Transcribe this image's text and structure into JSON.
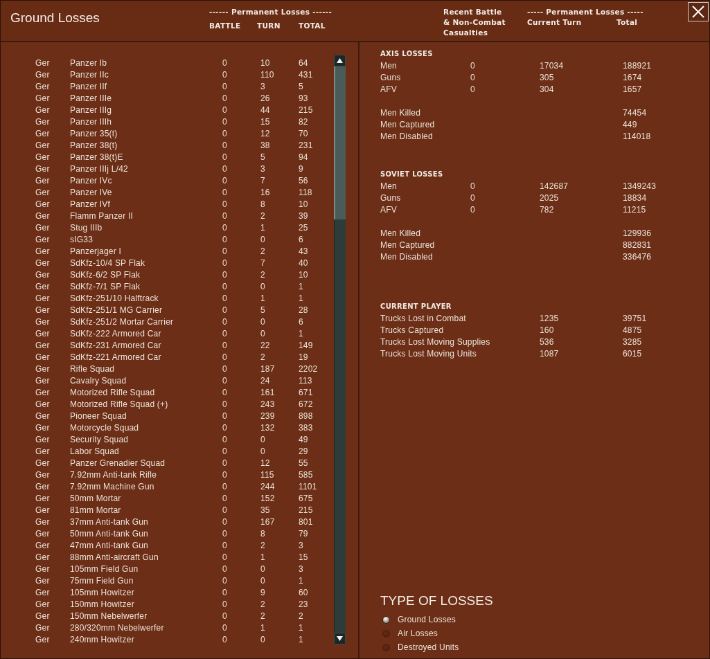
{
  "header": {
    "title": "Ground Losses",
    "unit_losses_heading": "------ Permanent Losses ------",
    "unit_columns": [
      "BATTLE",
      "TURN",
      "TOTAL"
    ],
    "recent_heading": [
      "Recent Battle",
      "& Non-Combat",
      "Casualties"
    ],
    "summary_heading": "----- Permanent Losses -----",
    "summary_columns": [
      "Current Turn",
      "Total"
    ]
  },
  "units": [
    {
      "nation": "Ger",
      "name": "Panzer Ib",
      "battle": "0",
      "turn": "10",
      "total": "64"
    },
    {
      "nation": "Ger",
      "name": "Panzer IIc",
      "battle": "0",
      "turn": "110",
      "total": "431"
    },
    {
      "nation": "Ger",
      "name": "Panzer IIf",
      "battle": "0",
      "turn": "3",
      "total": "5"
    },
    {
      "nation": "Ger",
      "name": "Panzer IIIe",
      "battle": "0",
      "turn": "26",
      "total": "93"
    },
    {
      "nation": "Ger",
      "name": "Panzer IIIg",
      "battle": "0",
      "turn": "44",
      "total": "215"
    },
    {
      "nation": "Ger",
      "name": "Panzer IIIh",
      "battle": "0",
      "turn": "15",
      "total": "82"
    },
    {
      "nation": "Ger",
      "name": "Panzer 35(t)",
      "battle": "0",
      "turn": "12",
      "total": "70"
    },
    {
      "nation": "Ger",
      "name": "Panzer 38(t)",
      "battle": "0",
      "turn": "38",
      "total": "231"
    },
    {
      "nation": "Ger",
      "name": "Panzer 38(t)E",
      "battle": "0",
      "turn": "5",
      "total": "94"
    },
    {
      "nation": "Ger",
      "name": "Panzer IIIj L/42",
      "battle": "0",
      "turn": "3",
      "total": "9"
    },
    {
      "nation": "Ger",
      "name": "Panzer IVc",
      "battle": "0",
      "turn": "7",
      "total": "56"
    },
    {
      "nation": "Ger",
      "name": "Panzer IVe",
      "battle": "0",
      "turn": "16",
      "total": "118"
    },
    {
      "nation": "Ger",
      "name": "Panzer IVf",
      "battle": "0",
      "turn": "8",
      "total": "10"
    },
    {
      "nation": "Ger",
      "name": "Flamm Panzer II",
      "battle": "0",
      "turn": "2",
      "total": "39"
    },
    {
      "nation": "Ger",
      "name": "Stug IIIb",
      "battle": "0",
      "turn": "1",
      "total": "25"
    },
    {
      "nation": "Ger",
      "name": "sIG33",
      "battle": "0",
      "turn": "0",
      "total": "6"
    },
    {
      "nation": "Ger",
      "name": "Panzerjager I",
      "battle": "0",
      "turn": "2",
      "total": "43"
    },
    {
      "nation": "Ger",
      "name": "SdKfz-10/4 SP Flak",
      "battle": "0",
      "turn": "7",
      "total": "40"
    },
    {
      "nation": "Ger",
      "name": "SdKfz-6/2 SP Flak",
      "battle": "0",
      "turn": "2",
      "total": "10"
    },
    {
      "nation": "Ger",
      "name": "SdKfz-7/1 SP Flak",
      "battle": "0",
      "turn": "0",
      "total": "1"
    },
    {
      "nation": "Ger",
      "name": "SdKfz-251/10 Halftrack",
      "battle": "0",
      "turn": "1",
      "total": "1"
    },
    {
      "nation": "Ger",
      "name": "SdKfz-251/1 MG Carrier",
      "battle": "0",
      "turn": "5",
      "total": "28"
    },
    {
      "nation": "Ger",
      "name": "SdKfz-251/2 Mortar Carrier",
      "battle": "0",
      "turn": "0",
      "total": "6"
    },
    {
      "nation": "Ger",
      "name": "SdKfz-222 Armored Car",
      "battle": "0",
      "turn": "0",
      "total": "1"
    },
    {
      "nation": "Ger",
      "name": "SdKfz-231 Armored Car",
      "battle": "0",
      "turn": "22",
      "total": "149"
    },
    {
      "nation": "Ger",
      "name": "SdKfz-221 Armored Car",
      "battle": "0",
      "turn": "2",
      "total": "19"
    },
    {
      "nation": "Ger",
      "name": "Rifle Squad",
      "battle": "0",
      "turn": "187",
      "total": "2202"
    },
    {
      "nation": "Ger",
      "name": "Cavalry Squad",
      "battle": "0",
      "turn": "24",
      "total": "113"
    },
    {
      "nation": "Ger",
      "name": "Motorized Rifle Squad",
      "battle": "0",
      "turn": "161",
      "total": "671"
    },
    {
      "nation": "Ger",
      "name": "Motorized Rifle Squad (+)",
      "battle": "0",
      "turn": "243",
      "total": "672"
    },
    {
      "nation": "Ger",
      "name": "Pioneer Squad",
      "battle": "0",
      "turn": "239",
      "total": "898"
    },
    {
      "nation": "Ger",
      "name": "Motorcycle Squad",
      "battle": "0",
      "turn": "132",
      "total": "383"
    },
    {
      "nation": "Ger",
      "name": "Security Squad",
      "battle": "0",
      "turn": "0",
      "total": "49"
    },
    {
      "nation": "Ger",
      "name": "Labor Squad",
      "battle": "0",
      "turn": "0",
      "total": "29"
    },
    {
      "nation": "Ger",
      "name": "Panzer Grenadier Squad",
      "battle": "0",
      "turn": "12",
      "total": "55"
    },
    {
      "nation": "Ger",
      "name": "7.92mm Anti-tank Rifle",
      "battle": "0",
      "turn": "115",
      "total": "585"
    },
    {
      "nation": "Ger",
      "name": "7.92mm Machine Gun",
      "battle": "0",
      "turn": "244",
      "total": "1101"
    },
    {
      "nation": "Ger",
      "name": "50mm Mortar",
      "battle": "0",
      "turn": "152",
      "total": "675"
    },
    {
      "nation": "Ger",
      "name": "81mm Mortar",
      "battle": "0",
      "turn": "35",
      "total": "215"
    },
    {
      "nation": "Ger",
      "name": "37mm Anti-tank Gun",
      "battle": "0",
      "turn": "167",
      "total": "801"
    },
    {
      "nation": "Ger",
      "name": "50mm Anti-tank Gun",
      "battle": "0",
      "turn": "8",
      "total": "79"
    },
    {
      "nation": "Ger",
      "name": "47mm Anti-tank Gun",
      "battle": "0",
      "turn": "2",
      "total": "3"
    },
    {
      "nation": "Ger",
      "name": "88mm Anti-aircraft Gun",
      "battle": "0",
      "turn": "1",
      "total": "15"
    },
    {
      "nation": "Ger",
      "name": "105mm Field Gun",
      "battle": "0",
      "turn": "0",
      "total": "3"
    },
    {
      "nation": "Ger",
      "name": "75mm Field Gun",
      "battle": "0",
      "turn": "0",
      "total": "1"
    },
    {
      "nation": "Ger",
      "name": "105mm Howitzer",
      "battle": "0",
      "turn": "9",
      "total": "60"
    },
    {
      "nation": "Ger",
      "name": "150mm Howitzer",
      "battle": "0",
      "turn": "2",
      "total": "23"
    },
    {
      "nation": "Ger",
      "name": "150mm Nebelwerfer",
      "battle": "0",
      "turn": "2",
      "total": "2"
    },
    {
      "nation": "Ger",
      "name": "280/320mm Nebelwerfer",
      "battle": "0",
      "turn": "1",
      "total": "1"
    },
    {
      "nation": "Ger",
      "name": "240mm Howitzer",
      "battle": "0",
      "turn": "0",
      "total": "1"
    }
  ],
  "summary": [
    {
      "title": "AXIS LOSSES",
      "groups": [
        {
          "rows": [
            {
              "label": "Men",
              "battle": "0",
              "turn": "17034",
              "total": "188921"
            },
            {
              "label": "Guns",
              "battle": "0",
              "turn": "305",
              "total": "1674"
            },
            {
              "label": "AFV",
              "battle": "0",
              "turn": "304",
              "total": "1657"
            }
          ]
        },
        {
          "rows": [
            {
              "label": "Men Killed",
              "total": "74454"
            },
            {
              "label": "Men Captured",
              "total": "449"
            },
            {
              "label": "Men Disabled",
              "total": "114018"
            }
          ]
        }
      ]
    },
    {
      "title": "SOVIET LOSSES",
      "groups": [
        {
          "rows": [
            {
              "label": "Men",
              "battle": "0",
              "turn": "142687",
              "total": "1349243"
            },
            {
              "label": "Guns",
              "battle": "0",
              "turn": "2025",
              "total": "18834"
            },
            {
              "label": "AFV",
              "battle": "0",
              "turn": "782",
              "total": "11215"
            }
          ]
        },
        {
          "rows": [
            {
              "label": "Men Killed",
              "total": "129936"
            },
            {
              "label": "Men Captured",
              "total": "882831"
            },
            {
              "label": "Men Disabled",
              "total": "336476"
            }
          ]
        }
      ]
    },
    {
      "title": "CURRENT PLAYER",
      "groups": [
        {
          "rows": [
            {
              "label": "Trucks Lost in Combat",
              "turn": "1235",
              "total": "39751"
            },
            {
              "label": "Trucks Captured",
              "turn": "160",
              "total": "4875"
            },
            {
              "label": "Trucks Lost Moving Supplies",
              "turn": "536",
              "total": "3285"
            },
            {
              "label": "Trucks Lost Moving Units",
              "turn": "1087",
              "total": "6015"
            }
          ]
        }
      ]
    }
  ],
  "loss_type": {
    "title": "TYPE OF LOSSES",
    "options": [
      {
        "label": "Ground Losses",
        "selected": true
      },
      {
        "label": "Air Losses",
        "selected": false
      },
      {
        "label": "Destroyed Units",
        "selected": false
      }
    ]
  }
}
